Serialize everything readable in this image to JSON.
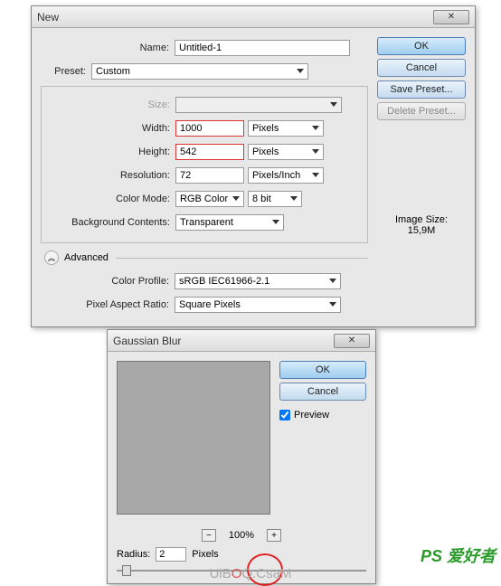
{
  "new_dialog": {
    "title": "New",
    "labels": {
      "name": "Name:",
      "preset": "Preset:",
      "size": "Size:",
      "width": "Width:",
      "height": "Height:",
      "resolution": "Resolution:",
      "color_mode": "Color Mode:",
      "bg_contents": "Background Contents:",
      "advanced": "Advanced",
      "color_profile": "Color Profile:",
      "pixel_aspect": "Pixel Aspect Ratio:",
      "image_size_label": "Image Size:",
      "image_size_value": "15,9M"
    },
    "values": {
      "name": "Untitled-1",
      "preset": "Custom",
      "size": "",
      "width": "1000",
      "width_unit": "Pixels",
      "height": "542",
      "height_unit": "Pixels",
      "resolution": "72",
      "resolution_unit": "Pixels/Inch",
      "color_mode": "RGB Color",
      "bit_depth": "8 bit",
      "bg_contents": "Transparent",
      "color_profile": "sRGB IEC61966-2.1",
      "pixel_aspect": "Square Pixels"
    },
    "buttons": {
      "ok": "OK",
      "cancel": "Cancel",
      "save_preset": "Save Preset...",
      "delete_preset": "Delete Preset..."
    }
  },
  "gauss_dialog": {
    "title": "Gaussian Blur",
    "buttons": {
      "ok": "OK",
      "cancel": "Cancel"
    },
    "preview_label": "Preview",
    "preview_checked": true,
    "zoom": "100%",
    "radius_label": "Radius:",
    "radius_value": "2",
    "radius_unit": "Pixels"
  },
  "watermark": {
    "ps": "PS 爱好者",
    "site_a": "UiB",
    "site_b": "O",
    "site_c": "Q.CsaM"
  }
}
